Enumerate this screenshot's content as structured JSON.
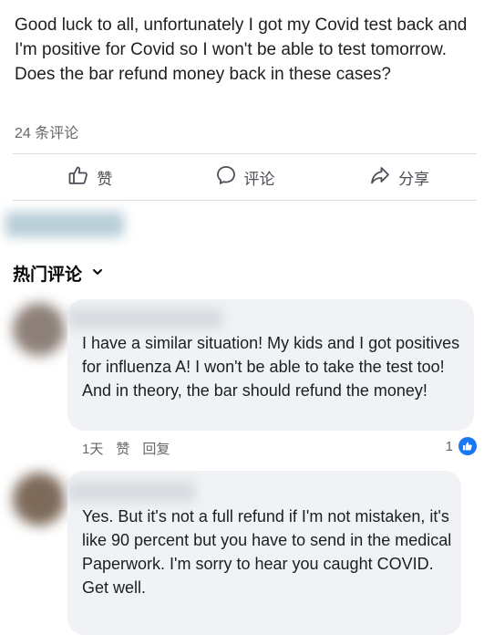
{
  "post": {
    "text": "Good luck to all, unfortunately I got my Covid test back and I'm positive for Covid so I won't be able to test tomorrow. Does the bar refund money back in these cases?",
    "comment_count": "24 条评论"
  },
  "actions": {
    "like_label": "赞",
    "comment_label": "评论",
    "share_label": "分享"
  },
  "comments_section": {
    "filter_label": "热门评论"
  },
  "comments": [
    {
      "text": "I have a similar situation! My kids and I got positives for influenza A! I won't be able to take the test too! And in theory, the bar should refund the money!",
      "time": "1天",
      "like_label": "赞",
      "reply_label": "回复",
      "reaction_count": "1"
    },
    {
      "text": "Yes. But it's not a full refund if I'm not mistaken, it's like 90 percent but you have to send in the medical\nPaperwork. I'm sorry to hear you caught COVID. Get well."
    }
  ],
  "colors": {
    "accent": "#1877f2",
    "bubble_bg": "#f0f2f5",
    "secondary_text": "#65676b"
  },
  "icons": {
    "like": "thumbs-up-icon",
    "comment": "speech-bubble-icon",
    "share": "share-arrow-icon",
    "dropdown": "chevron-down-icon",
    "reaction": "like-reaction-icon"
  }
}
